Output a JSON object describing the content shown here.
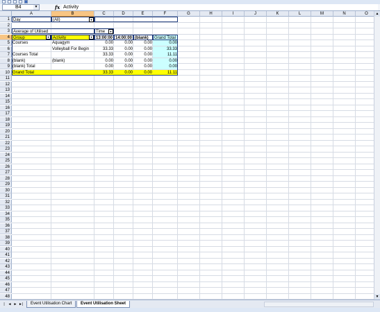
{
  "name_box": {
    "value": "B4",
    "arrow": "▼"
  },
  "formula": {
    "fx": "fx",
    "content": "Activity"
  },
  "columns": [
    "A",
    "B",
    "C",
    "D",
    "E",
    "F",
    "G",
    "H",
    "I",
    "J",
    "K",
    "L",
    "M",
    "N",
    "O"
  ],
  "selected_column": "B",
  "selected_row": "4",
  "rows": [
    "1",
    "2",
    "3",
    "4",
    "5",
    "6",
    "7",
    "8",
    "9",
    "10",
    "11",
    "12",
    "13",
    "14",
    "15",
    "16",
    "17",
    "18",
    "19",
    "20",
    "21",
    "22",
    "23",
    "24",
    "25",
    "26",
    "27",
    "28",
    "29",
    "30",
    "31",
    "32",
    "33",
    "34",
    "35",
    "36",
    "37",
    "38",
    "39",
    "40",
    "41",
    "42",
    "43",
    "44",
    "45",
    "46",
    "47",
    "48"
  ],
  "pivot": {
    "page_field_label": "Day",
    "page_field_value": "(All)",
    "data_label": "Average of Utilised",
    "col_field": "Time",
    "header_row": {
      "group": "Group",
      "activity": "Activity",
      "c": "13:00:00",
      "d": "14:00:00",
      "e": "(blank)",
      "f": "Grand Total"
    },
    "row5": {
      "a": "Courses",
      "b": "Aquagym",
      "c": "0.00",
      "d": "0.00",
      "e": "0.00",
      "f": "0.00"
    },
    "row6": {
      "a": "",
      "b": "Volleyball For Begin",
      "c": "33.33",
      "d": "0.00",
      "e": "0.00",
      "f": "33.33"
    },
    "row7": {
      "a": "Courses Total",
      "b": "",
      "c": "33.33",
      "d": "0.00",
      "e": "0.00",
      "f": "11.11"
    },
    "row8": {
      "a": "(blank)",
      "b": "(blank)",
      "c": "0.00",
      "d": "0.00",
      "e": "0.00",
      "f": "0.00"
    },
    "row9": {
      "a": "(blank) Total",
      "b": "",
      "c": "0.00",
      "d": "0.00",
      "e": "0.00",
      "f": "0.00"
    },
    "row10": {
      "a": "Grand Total",
      "b": "",
      "c": "33.33",
      "d": "0.00",
      "e": "0.00",
      "f": "11.11"
    }
  },
  "sheet_tabs": [
    "Event Utilisation Chart",
    "Event Utilisation Sheet"
  ],
  "active_tab": "Event Utilisation Sheet",
  "tab_nav": [
    "|◄",
    "◄",
    "►",
    "►|"
  ],
  "colors": {
    "pivot_highlight": "#ffff00",
    "grand_total_col": "#ccffff",
    "selection": "#f8c584"
  }
}
